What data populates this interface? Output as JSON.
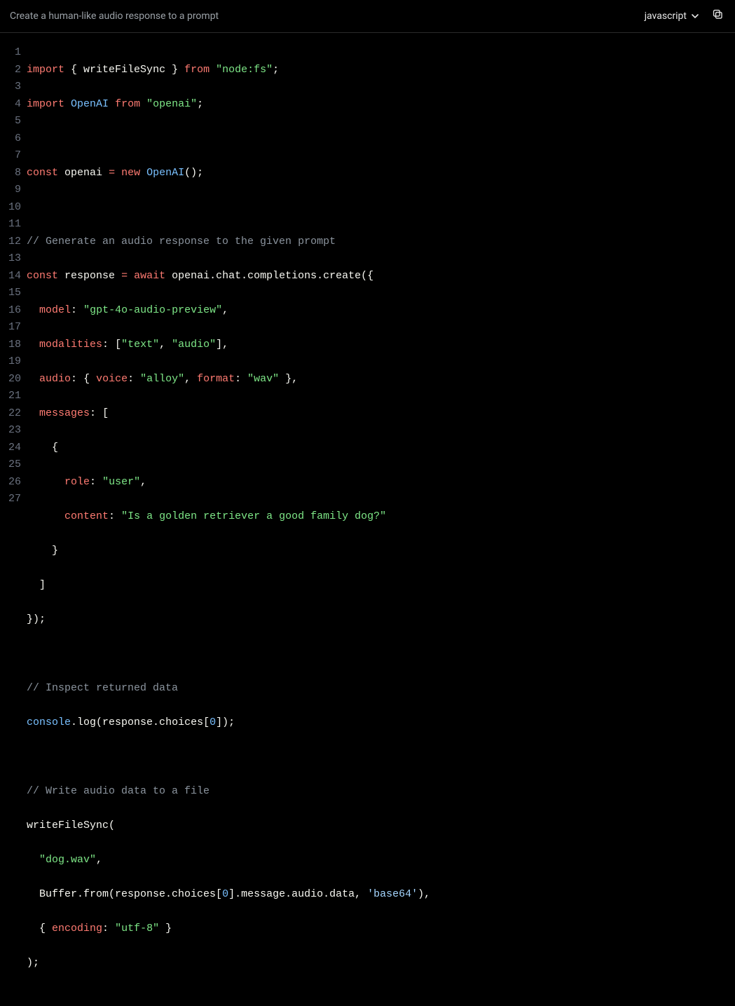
{
  "header": {
    "title": "Create a human-like audio response to a prompt",
    "language": "javascript"
  },
  "code": {
    "line1": {
      "kw1": "import",
      "brace_o": "{ ",
      "ident": "writeFileSync",
      "brace_c": " }",
      "kw2": "from",
      "str": "\"node:fs\"",
      "semi": ";"
    },
    "line2": {
      "kw1": "import",
      "ident": "OpenAI",
      "kw2": "from",
      "str": "\"openai\"",
      "semi": ";"
    },
    "line4": {
      "kw1": "const",
      "ident": "openai",
      "eq": "=",
      "kw2": "new",
      "cls": "OpenAI",
      "call": "();"
    },
    "line6": {
      "comment": "// Generate an audio response to the given prompt"
    },
    "line7": {
      "kw1": "const",
      "ident": "response",
      "eq": "=",
      "kw2": "await",
      "chain": "openai.chat.completions.create({"
    },
    "line8": {
      "key": "model",
      "colon": ":",
      "str": "\"gpt-4o-audio-preview\"",
      "comma": ","
    },
    "line9": {
      "key": "modalities",
      "colon": ":",
      "open": "[",
      "s1": "\"text\"",
      "c": ", ",
      "s2": "\"audio\"",
      "close": "],"
    },
    "line10": {
      "key": "audio",
      "colon": ":",
      "open": "{ ",
      "k1": "voice",
      "c1": ": ",
      "s1": "\"alloy\"",
      "c2": ", ",
      "k2": "format",
      "c3": ": ",
      "s2": "\"wav\"",
      "close": " },"
    },
    "line11": {
      "key": "messages",
      "colon": ":",
      "open": "["
    },
    "line12": {
      "open": "{"
    },
    "line13": {
      "key": "role",
      "colon": ":",
      "str": "\"user\"",
      "comma": ","
    },
    "line14": {
      "key": "content",
      "colon": ":",
      "str": "\"Is a golden retriever a good family dog?\""
    },
    "line15": {
      "close": "}"
    },
    "line16": {
      "close": "]"
    },
    "line17": {
      "close": "});"
    },
    "line19": {
      "comment": "// Inspect returned data"
    },
    "line20": {
      "obj": "console",
      "dot": ".",
      "m": "log",
      "open": "(response.choices[",
      "idx": "0",
      "close": "]);"
    },
    "line22": {
      "comment": "// Write audio data to a file"
    },
    "line23": {
      "fn": "writeFileSync",
      "open": "("
    },
    "line24": {
      "str": "\"dog.wav\"",
      "comma": ","
    },
    "line25": {
      "pre": "Buffer.from(response.choices[",
      "idx": "0",
      "mid": "].message.audio.data, ",
      "str": "'base64'",
      "close": "),"
    },
    "line26": {
      "open": "{ ",
      "key": "encoding",
      "colon": ": ",
      "str": "\"utf-8\"",
      "close": " }"
    },
    "line27": {
      "close": ");"
    }
  },
  "lines": [
    "1",
    "2",
    "3",
    "4",
    "5",
    "6",
    "7",
    "8",
    "9",
    "10",
    "11",
    "12",
    "13",
    "14",
    "15",
    "16",
    "17",
    "18",
    "19",
    "20",
    "21",
    "22",
    "23",
    "24",
    "25",
    "26",
    "27"
  ]
}
